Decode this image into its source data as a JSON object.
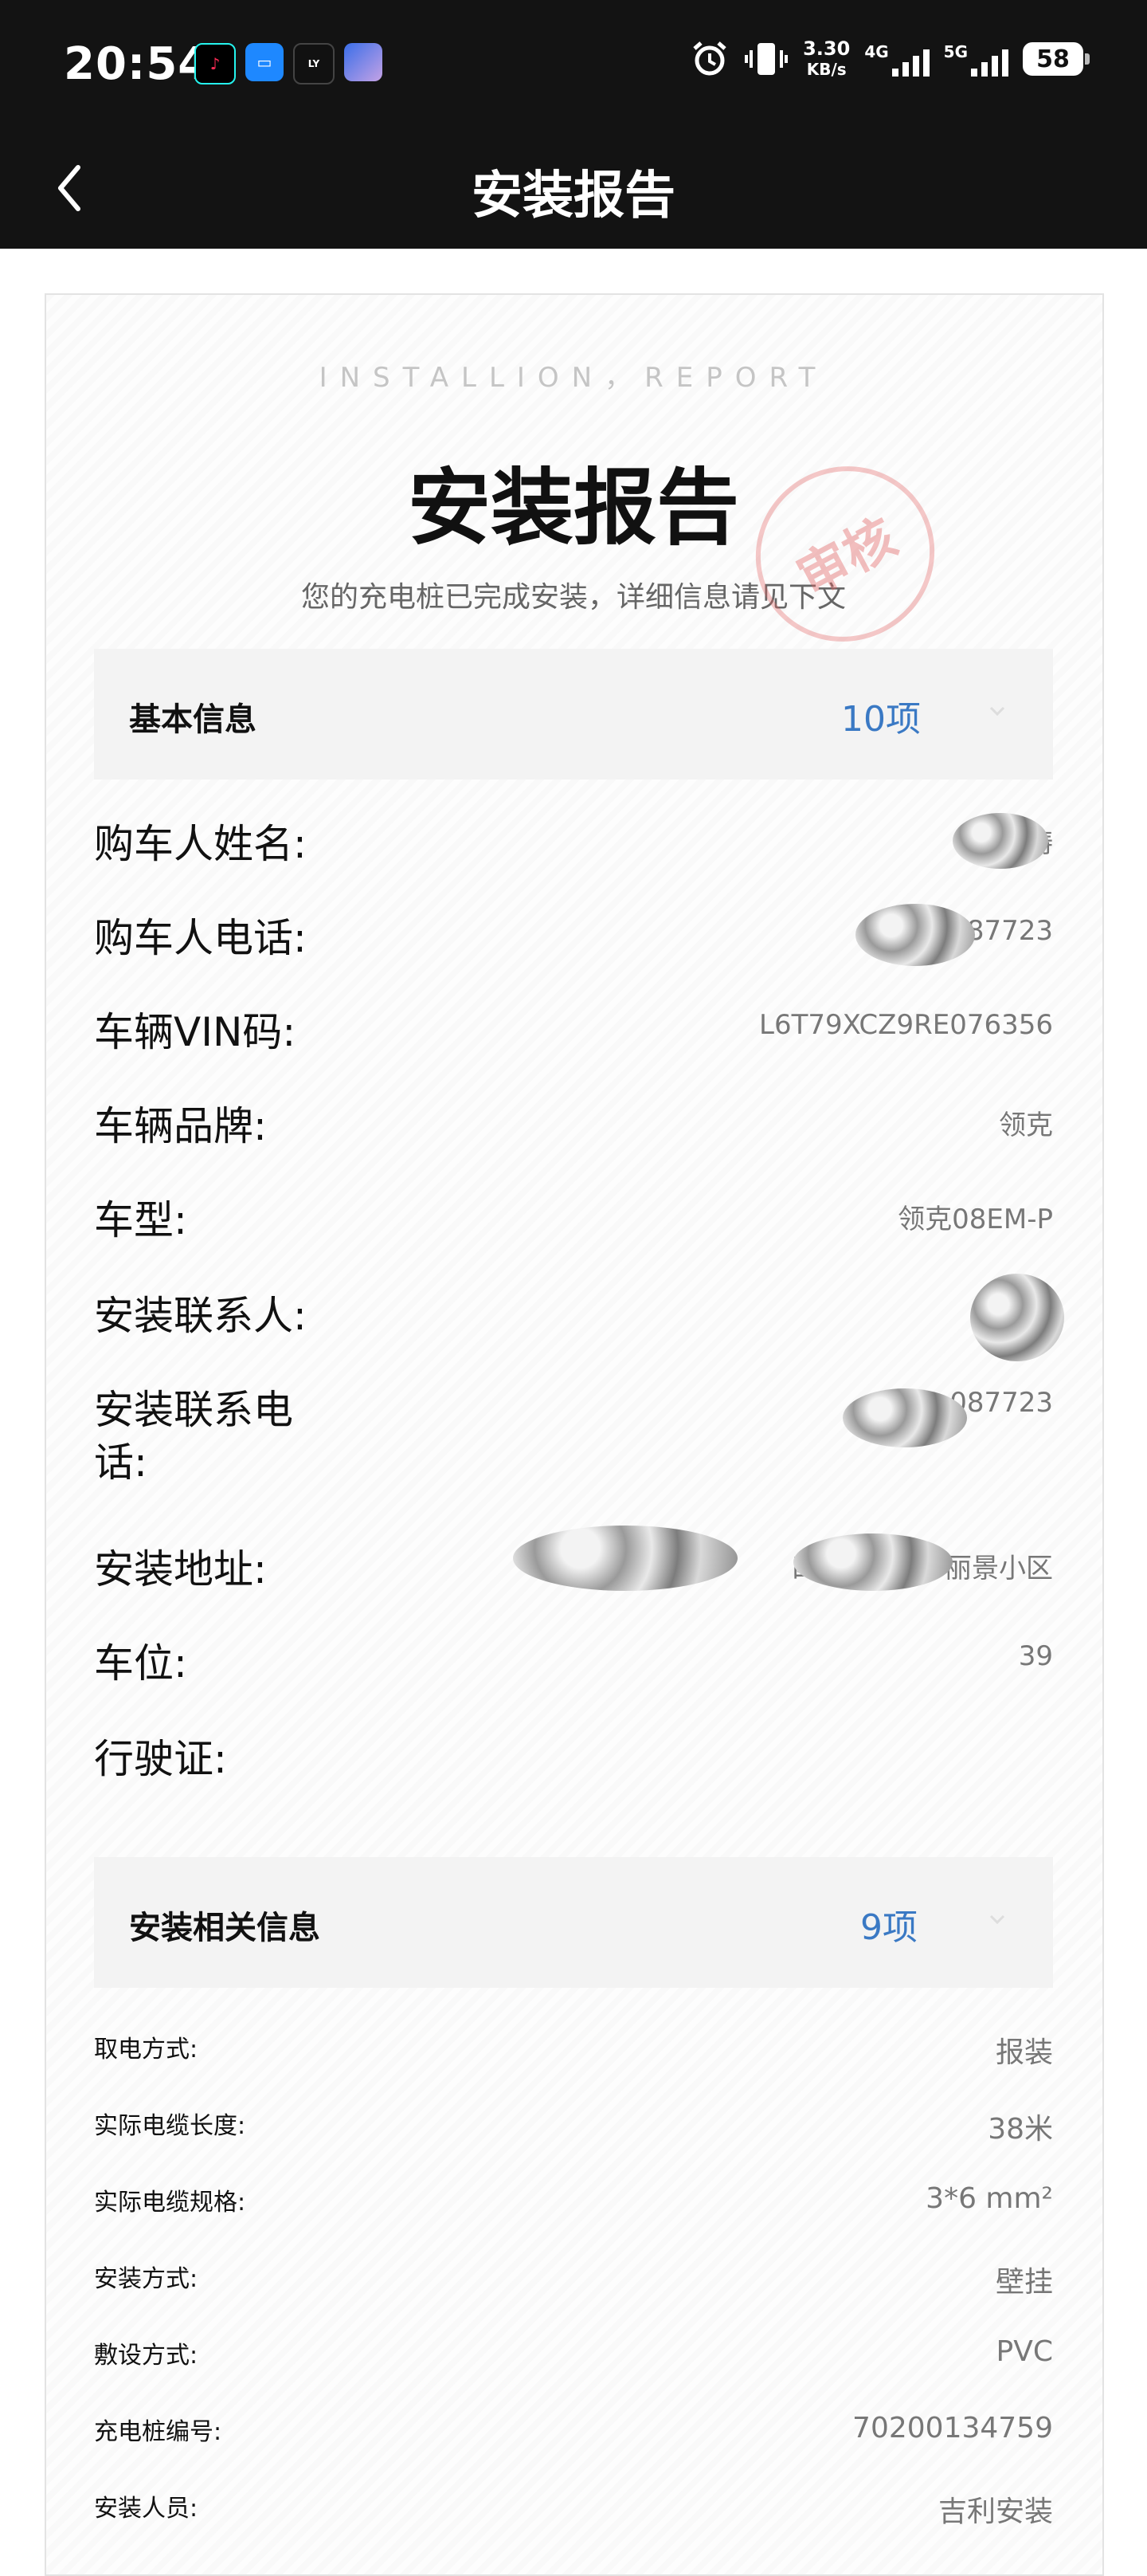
{
  "status_bar": {
    "time": "20:54",
    "speed_value": "3.30",
    "speed_unit": "KB/s",
    "net_4g": "4G",
    "net_5g": "5G",
    "battery": "58",
    "app_icons": [
      "douyin-icon",
      "message-icon",
      "lynkco-icon",
      "game-avatar-icon"
    ]
  },
  "nav": {
    "title": "安装报告",
    "back_icon": "chevron-left-icon"
  },
  "report": {
    "eng_title": "INSTALLION，REPORT",
    "title": "安装报告",
    "subtitle": "您的充电桩已完成安装，详细信息请见下文",
    "stamp": "审核"
  },
  "basic": {
    "title": "基本信息",
    "count": "10项",
    "rows": [
      {
        "label": "购车人姓名:",
        "value": "涛"
      },
      {
        "label": "购车人电话:",
        "value": "87723"
      },
      {
        "label": "车辆VIN码:",
        "value": "L6T79XCZ9RE076356"
      },
      {
        "label": "车辆品牌:",
        "value": "领克"
      },
      {
        "label": "车型:",
        "value": "领克08EM-P"
      },
      {
        "label": "安装联系人:",
        "value": ""
      },
      {
        "label": "安装联系电话:",
        "value": "087723"
      },
      {
        "label": "安装地址:",
        "value": "四川省 七里 丽景小区"
      },
      {
        "label": "车位:",
        "value": "39"
      },
      {
        "label": "行驶证:",
        "value": ""
      }
    ]
  },
  "install": {
    "title": "安装相关信息",
    "count": "9项",
    "rows": [
      {
        "label": "取电方式:",
        "value": "报装"
      },
      {
        "label": "实际电缆长度:",
        "value": "38米"
      },
      {
        "label": "实际电缆规格:",
        "value": "3*6 mm²"
      },
      {
        "label": "安装方式:",
        "value": "壁挂"
      },
      {
        "label": "敷设方式:",
        "value": "PVC"
      },
      {
        "label": "充电桩编号:",
        "value": "70200134759"
      },
      {
        "label": "安装人员:",
        "value": "吉利安装"
      }
    ]
  },
  "colors": {
    "accent": "#3a79c4",
    "dark_bar": "#131313"
  }
}
